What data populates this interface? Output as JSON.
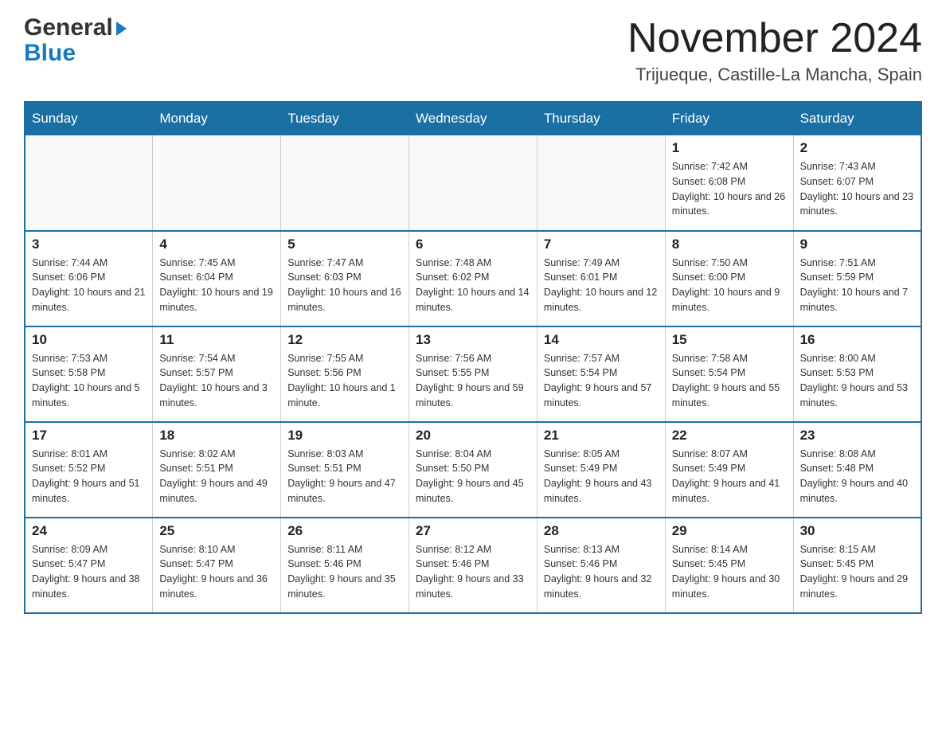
{
  "header": {
    "logo_general": "General",
    "logo_blue": "Blue",
    "month_title": "November 2024",
    "location": "Trijueque, Castille-La Mancha, Spain"
  },
  "weekdays": [
    "Sunday",
    "Monday",
    "Tuesday",
    "Wednesday",
    "Thursday",
    "Friday",
    "Saturday"
  ],
  "weeks": [
    [
      {
        "day": "",
        "info": ""
      },
      {
        "day": "",
        "info": ""
      },
      {
        "day": "",
        "info": ""
      },
      {
        "day": "",
        "info": ""
      },
      {
        "day": "",
        "info": ""
      },
      {
        "day": "1",
        "info": "Sunrise: 7:42 AM\nSunset: 6:08 PM\nDaylight: 10 hours and 26 minutes."
      },
      {
        "day": "2",
        "info": "Sunrise: 7:43 AM\nSunset: 6:07 PM\nDaylight: 10 hours and 23 minutes."
      }
    ],
    [
      {
        "day": "3",
        "info": "Sunrise: 7:44 AM\nSunset: 6:06 PM\nDaylight: 10 hours and 21 minutes."
      },
      {
        "day": "4",
        "info": "Sunrise: 7:45 AM\nSunset: 6:04 PM\nDaylight: 10 hours and 19 minutes."
      },
      {
        "day": "5",
        "info": "Sunrise: 7:47 AM\nSunset: 6:03 PM\nDaylight: 10 hours and 16 minutes."
      },
      {
        "day": "6",
        "info": "Sunrise: 7:48 AM\nSunset: 6:02 PM\nDaylight: 10 hours and 14 minutes."
      },
      {
        "day": "7",
        "info": "Sunrise: 7:49 AM\nSunset: 6:01 PM\nDaylight: 10 hours and 12 minutes."
      },
      {
        "day": "8",
        "info": "Sunrise: 7:50 AM\nSunset: 6:00 PM\nDaylight: 10 hours and 9 minutes."
      },
      {
        "day": "9",
        "info": "Sunrise: 7:51 AM\nSunset: 5:59 PM\nDaylight: 10 hours and 7 minutes."
      }
    ],
    [
      {
        "day": "10",
        "info": "Sunrise: 7:53 AM\nSunset: 5:58 PM\nDaylight: 10 hours and 5 minutes."
      },
      {
        "day": "11",
        "info": "Sunrise: 7:54 AM\nSunset: 5:57 PM\nDaylight: 10 hours and 3 minutes."
      },
      {
        "day": "12",
        "info": "Sunrise: 7:55 AM\nSunset: 5:56 PM\nDaylight: 10 hours and 1 minute."
      },
      {
        "day": "13",
        "info": "Sunrise: 7:56 AM\nSunset: 5:55 PM\nDaylight: 9 hours and 59 minutes."
      },
      {
        "day": "14",
        "info": "Sunrise: 7:57 AM\nSunset: 5:54 PM\nDaylight: 9 hours and 57 minutes."
      },
      {
        "day": "15",
        "info": "Sunrise: 7:58 AM\nSunset: 5:54 PM\nDaylight: 9 hours and 55 minutes."
      },
      {
        "day": "16",
        "info": "Sunrise: 8:00 AM\nSunset: 5:53 PM\nDaylight: 9 hours and 53 minutes."
      }
    ],
    [
      {
        "day": "17",
        "info": "Sunrise: 8:01 AM\nSunset: 5:52 PM\nDaylight: 9 hours and 51 minutes."
      },
      {
        "day": "18",
        "info": "Sunrise: 8:02 AM\nSunset: 5:51 PM\nDaylight: 9 hours and 49 minutes."
      },
      {
        "day": "19",
        "info": "Sunrise: 8:03 AM\nSunset: 5:51 PM\nDaylight: 9 hours and 47 minutes."
      },
      {
        "day": "20",
        "info": "Sunrise: 8:04 AM\nSunset: 5:50 PM\nDaylight: 9 hours and 45 minutes."
      },
      {
        "day": "21",
        "info": "Sunrise: 8:05 AM\nSunset: 5:49 PM\nDaylight: 9 hours and 43 minutes."
      },
      {
        "day": "22",
        "info": "Sunrise: 8:07 AM\nSunset: 5:49 PM\nDaylight: 9 hours and 41 minutes."
      },
      {
        "day": "23",
        "info": "Sunrise: 8:08 AM\nSunset: 5:48 PM\nDaylight: 9 hours and 40 minutes."
      }
    ],
    [
      {
        "day": "24",
        "info": "Sunrise: 8:09 AM\nSunset: 5:47 PM\nDaylight: 9 hours and 38 minutes."
      },
      {
        "day": "25",
        "info": "Sunrise: 8:10 AM\nSunset: 5:47 PM\nDaylight: 9 hours and 36 minutes."
      },
      {
        "day": "26",
        "info": "Sunrise: 8:11 AM\nSunset: 5:46 PM\nDaylight: 9 hours and 35 minutes."
      },
      {
        "day": "27",
        "info": "Sunrise: 8:12 AM\nSunset: 5:46 PM\nDaylight: 9 hours and 33 minutes."
      },
      {
        "day": "28",
        "info": "Sunrise: 8:13 AM\nSunset: 5:46 PM\nDaylight: 9 hours and 32 minutes."
      },
      {
        "day": "29",
        "info": "Sunrise: 8:14 AM\nSunset: 5:45 PM\nDaylight: 9 hours and 30 minutes."
      },
      {
        "day": "30",
        "info": "Sunrise: 8:15 AM\nSunset: 5:45 PM\nDaylight: 9 hours and 29 minutes."
      }
    ]
  ]
}
